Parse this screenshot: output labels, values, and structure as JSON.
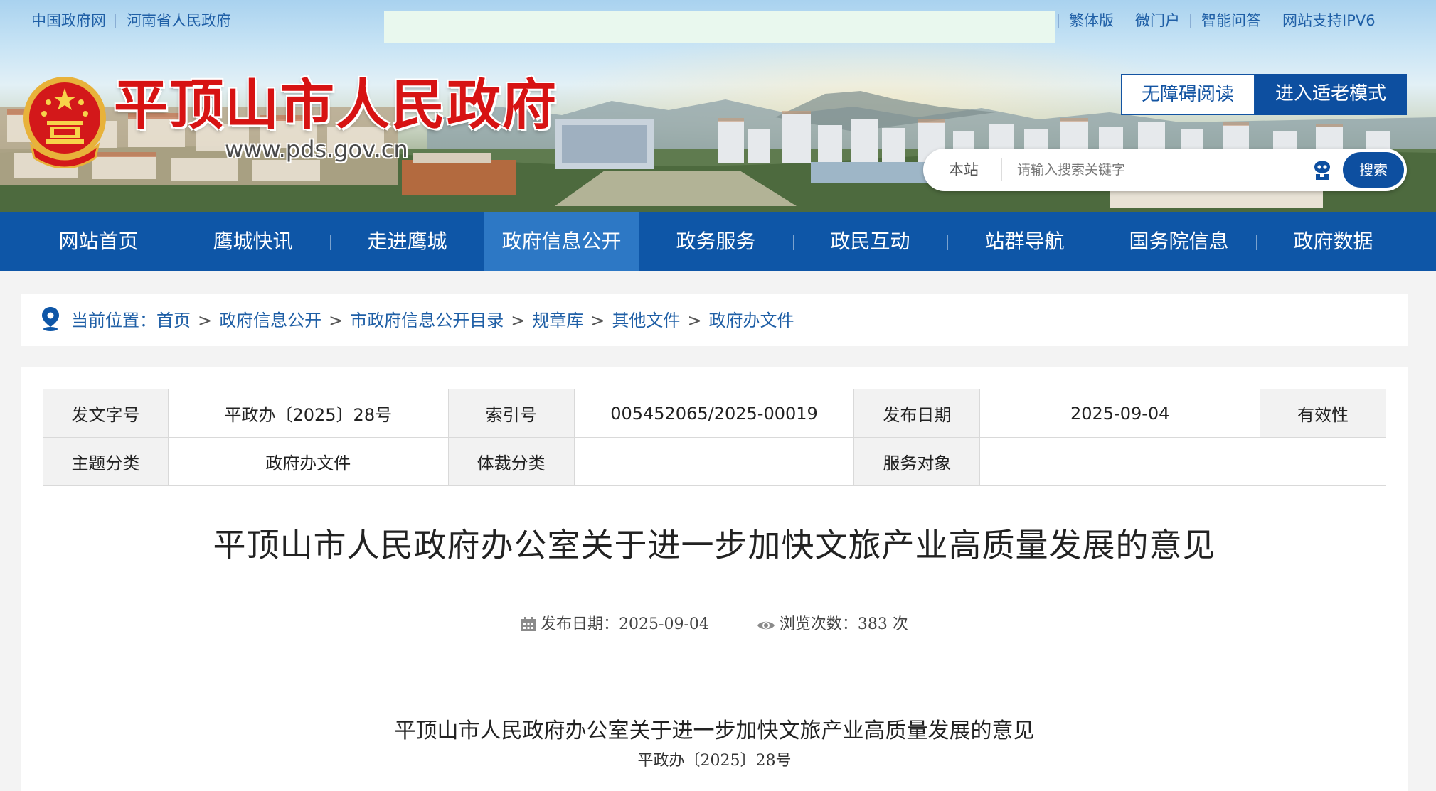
{
  "topbar": {
    "left_links": [
      "中国政府网",
      "河南省人民政府"
    ],
    "right_links": [
      "繁体版",
      "微门户",
      "智能问答",
      "网站支持IPV6"
    ]
  },
  "brand": {
    "title": "平顶山市人民政府",
    "url": "www.pds.gov.cn",
    "emblem_icon": "national-emblem-icon"
  },
  "access": {
    "a11y_label": "无障碍阅读",
    "elder_label": "进入适老模式"
  },
  "search": {
    "scope": "本站",
    "placeholder": "请输入搜索关键字",
    "button": "搜索",
    "assistant_icon": "robot-icon"
  },
  "nav": {
    "items": [
      "网站首页",
      "鹰城快讯",
      "走进鹰城",
      "政府信息公开",
      "政务服务",
      "政民互动",
      "站群导航",
      "国务院信息",
      "政府数据"
    ],
    "active": "政府信息公开"
  },
  "breadcrumb": {
    "prefix": "当前位置：",
    "items": [
      "首页",
      "政府信息公开",
      "市政府信息公开目录",
      "规章库",
      "其他文件",
      "政府办文件"
    ],
    "separator": ">"
  },
  "meta": {
    "row1": [
      {
        "label": "发文字号",
        "value": "平政办〔2025〕28号"
      },
      {
        "label": "索引号",
        "value": "005452065/2025-00019"
      },
      {
        "label": "发布日期",
        "value": "2025-09-04"
      },
      {
        "label": "有效性",
        "value": ""
      }
    ],
    "row2": [
      {
        "label": "主题分类",
        "value": "政府办文件"
      },
      {
        "label": "体裁分类",
        "value": ""
      },
      {
        "label": "服务对象",
        "value": ""
      }
    ]
  },
  "article": {
    "title": "平顶山市人民政府办公室关于进一步加快文旅产业高质量发展的意见",
    "publish_label": "发布日期：",
    "publish_date": "2025-09-04",
    "views_label": "浏览次数：",
    "views_count": "383",
    "views_unit": "次",
    "body_title": "平顶山市人民政府办公室关于进一步加快文旅产业高质量发展的意见",
    "doc_number": "平政办〔2025〕28号"
  },
  "colors": {
    "brand_red": "#d71313",
    "nav_blue": "#0e56a7",
    "nav_active": "#2d78c5",
    "link_blue": "#1f5fa6"
  }
}
